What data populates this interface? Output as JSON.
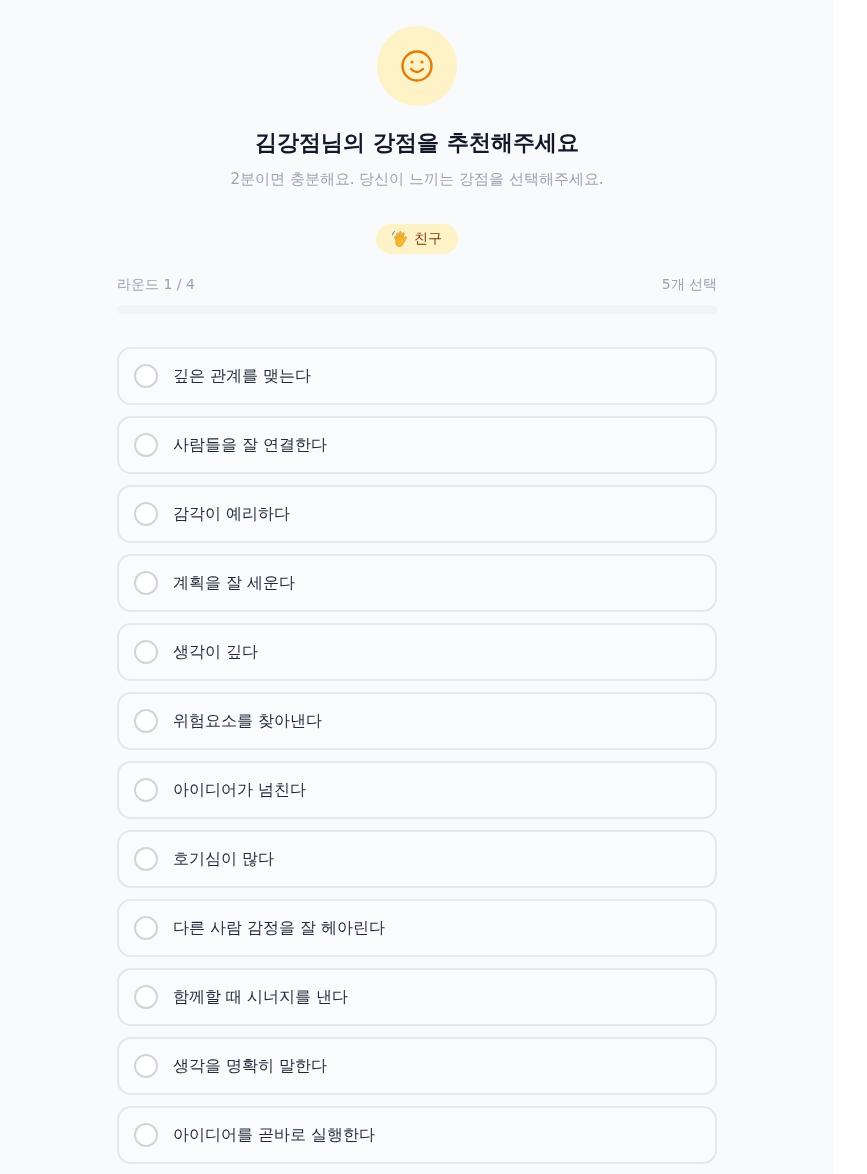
{
  "header": {
    "title": "김강점님의 강점을 추천해주세요",
    "subtitle": "2분이면 충분해요. 당신이 느끼는 강점을 선택해주세요."
  },
  "category_badge": {
    "label": "친구"
  },
  "progress": {
    "round": "라운드 1 / 4",
    "selection_count": "5개 선택"
  },
  "options": [
    {
      "label": "깊은 관계를 맺는다",
      "selected": false
    },
    {
      "label": "사람들을 잘 연결한다",
      "selected": false
    },
    {
      "label": "감각이 예리하다",
      "selected": false
    },
    {
      "label": "계획을 잘 세운다",
      "selected": false
    },
    {
      "label": "생각이 깊다",
      "selected": false
    },
    {
      "label": "위험요소를 찾아낸다",
      "selected": false
    },
    {
      "label": "아이디어가 넘친다",
      "selected": false
    },
    {
      "label": "호기심이 많다",
      "selected": false
    },
    {
      "label": "다른 사람 감정을 잘 헤아린다",
      "selected": false
    },
    {
      "label": "함께할 때 시너지를 낸다",
      "selected": false
    },
    {
      "label": "생각을 명확히 말한다",
      "selected": false
    },
    {
      "label": "아이디어를 곧바로 실행한다",
      "selected": false
    }
  ]
}
